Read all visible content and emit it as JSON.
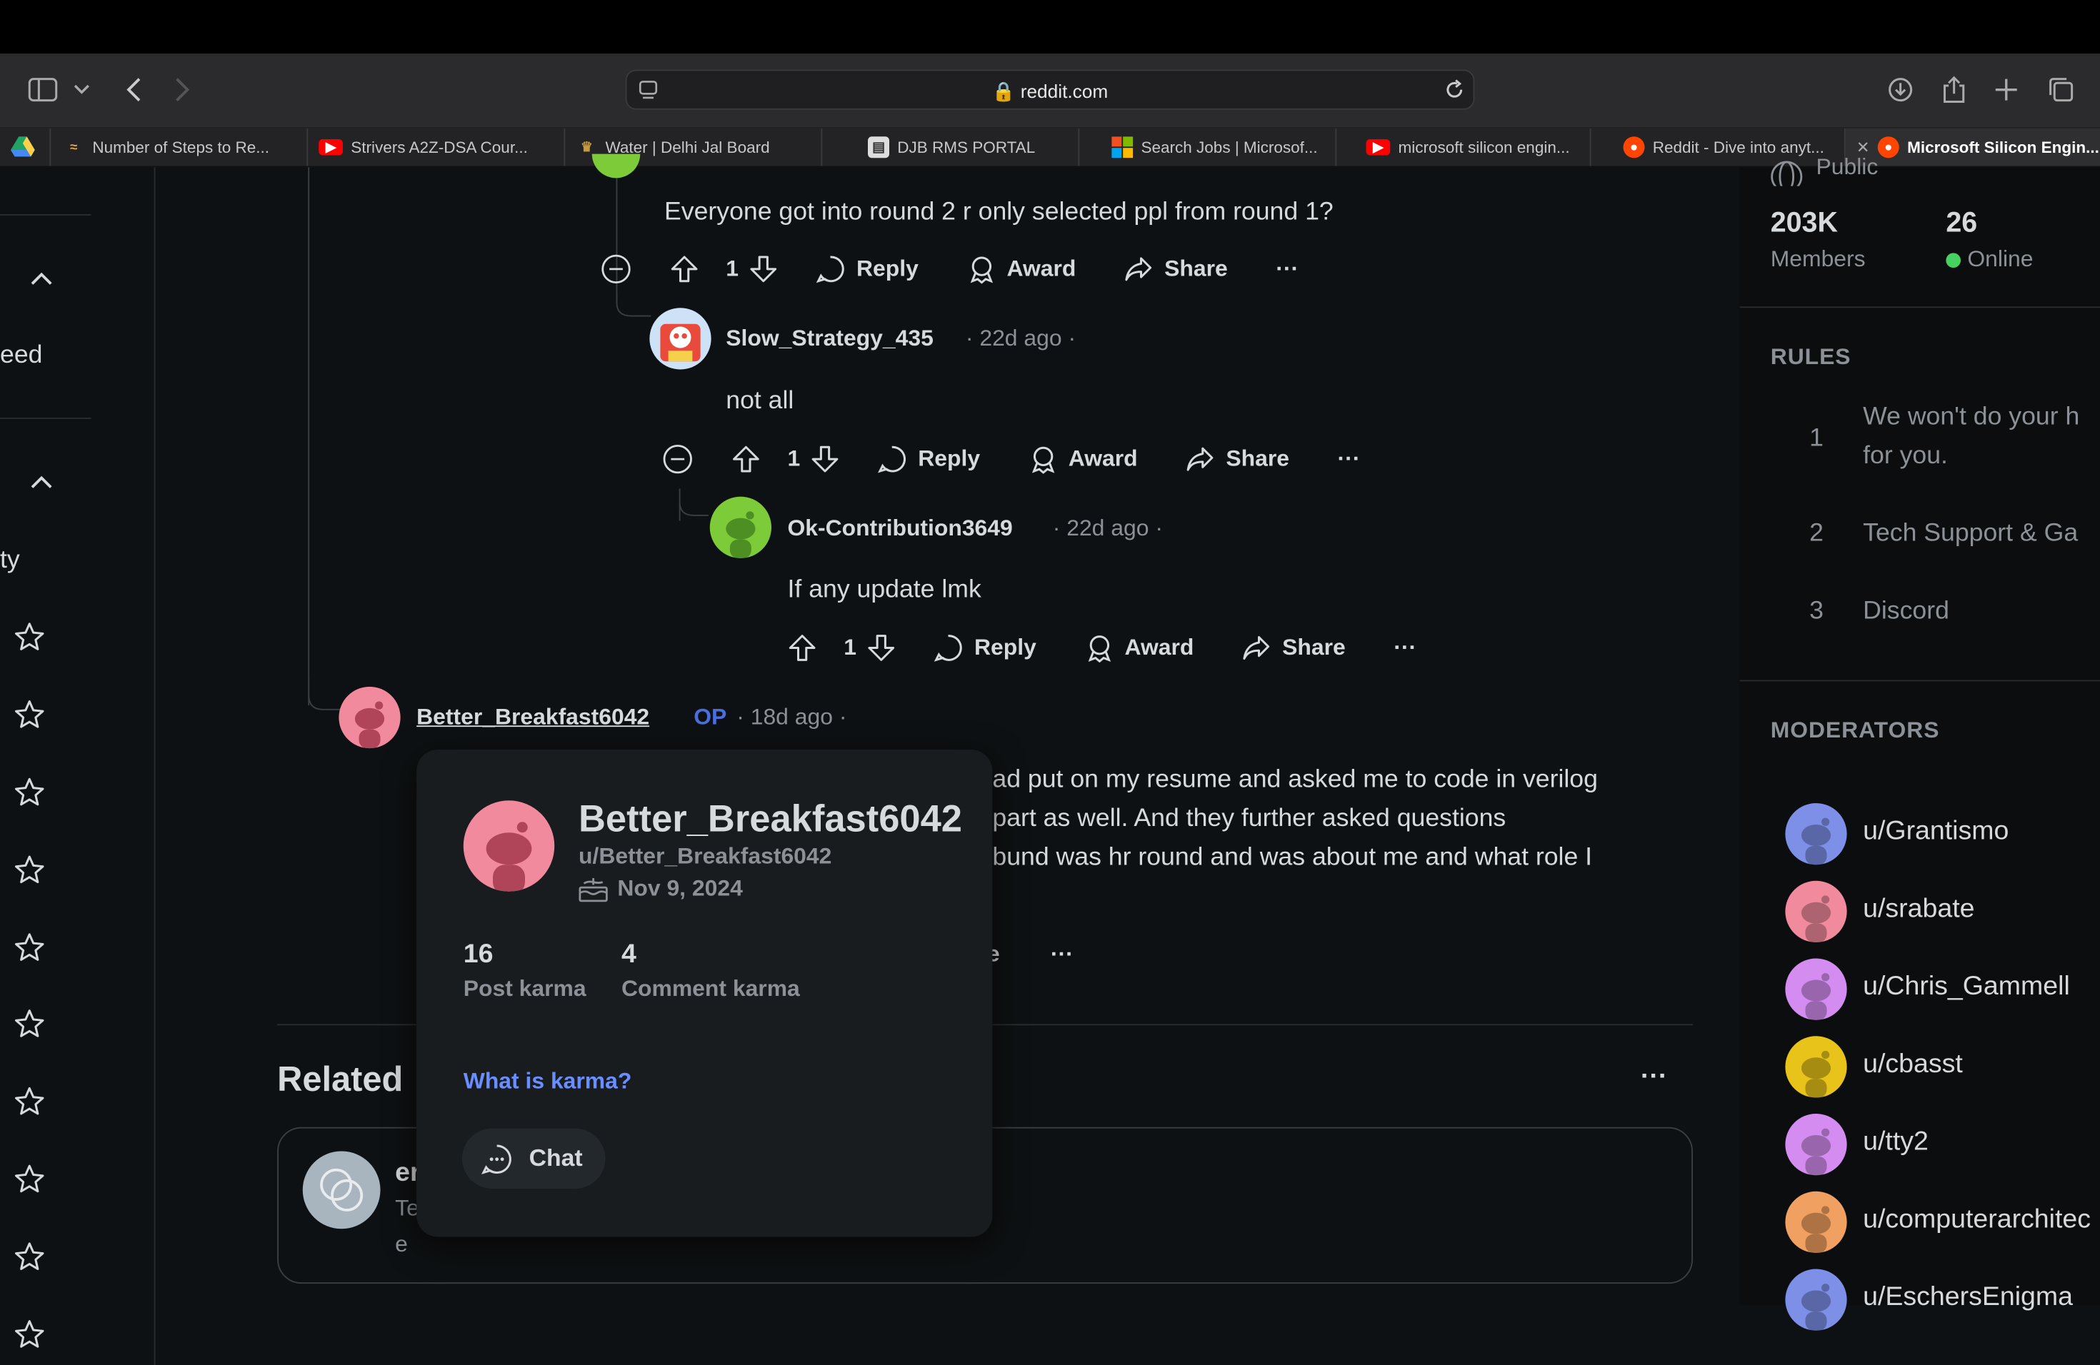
{
  "browser": {
    "url": "reddit.com",
    "tabs": [
      {
        "label": "Number of Steps to Re...",
        "color": "#e8a33d"
      },
      {
        "label": "Strivers A2Z-DSA Cour...",
        "color": "#ff0000"
      },
      {
        "label": "Water | Delhi Jal Board",
        "color": "#c89a3a"
      },
      {
        "label": "DJB RMS PORTAL",
        "color": "#dddddd"
      },
      {
        "label": "Search Jobs | Microsof...",
        "color": "#00a4ef"
      },
      {
        "label": "microsoft silicon engin...",
        "color": "#ff0000"
      },
      {
        "label": "Reddit - Dive into anyt...",
        "color": "#ff4500"
      },
      {
        "label": "Microsoft Silicon Engin...",
        "color": "#ff4500"
      }
    ]
  },
  "leftnav": {
    "items": [
      "eed",
      "ty"
    ]
  },
  "thread": {
    "comment1": {
      "text": "Everyone got into round 2 r only selected ppl from round 1?",
      "votes": "1"
    },
    "comment2": {
      "author": "Slow_Strategy_435",
      "age": "22d ago",
      "text": "not all",
      "votes": "1"
    },
    "comment3": {
      "author": "Ok-Contribution3649",
      "age": "22d ago",
      "text": "If any update lmk",
      "votes": "1"
    },
    "comment4": {
      "author": "Better_Breakfast6042",
      "op": "OP",
      "age": "18d ago",
      "lines": [
        "ad put on my resume and asked me to code in verilog",
        "part as well. And they further asked questions",
        "bund was hr round and was about me and what role I"
      ],
      "partial_action": "e"
    },
    "actions": {
      "reply": "Reply",
      "award": "Award",
      "share": "Share",
      "more": "···"
    }
  },
  "related": {
    "title": "Related",
    "card_title": "er",
    "card_line1": "Te",
    "card_line2": "e"
  },
  "popover": {
    "display_name": "Better_Breakfast6042",
    "username": "u/Better_Breakfast6042",
    "cake_day": "Nov 9, 2024",
    "post_karma": "16",
    "post_karma_label": "Post karma",
    "comment_karma": "4",
    "comment_karma_label": "Comment karma",
    "karma_link": "What is karma?",
    "chat_label": "Chat"
  },
  "sidebar": {
    "public_label": "Public",
    "members_count": "203K",
    "members_label": "Members",
    "online_count": "26",
    "online_label": "Online",
    "rules_heading": "RULES",
    "rules": [
      {
        "num": "1",
        "line1": "We won't do your h",
        "line2": "for you."
      },
      {
        "num": "2",
        "line1": "Tech Support & Ga",
        "line2": ""
      },
      {
        "num": "3",
        "line1": "Discord",
        "line2": ""
      }
    ],
    "moderators_heading": "MODERATORS",
    "moderators": [
      {
        "name": "u/Grantismo",
        "color": "#7d8fe6"
      },
      {
        "name": "u/srabate",
        "color": "#f08a9c"
      },
      {
        "name": "u/Chris_Gammell",
        "color": "#d48cf0"
      },
      {
        "name": "u/cbasst",
        "color": "#e8c31a"
      },
      {
        "name": "u/tty2",
        "color": "#d48cf0"
      },
      {
        "name": "u/computerarchitec",
        "color": "#f0a060"
      },
      {
        "name": "u/EschersEnigma",
        "color": "#7d8fe6"
      }
    ]
  },
  "colors": {
    "op_blue": "#4a6ee0",
    "link_blue": "#6a8eff",
    "online_green": "#46d160"
  }
}
